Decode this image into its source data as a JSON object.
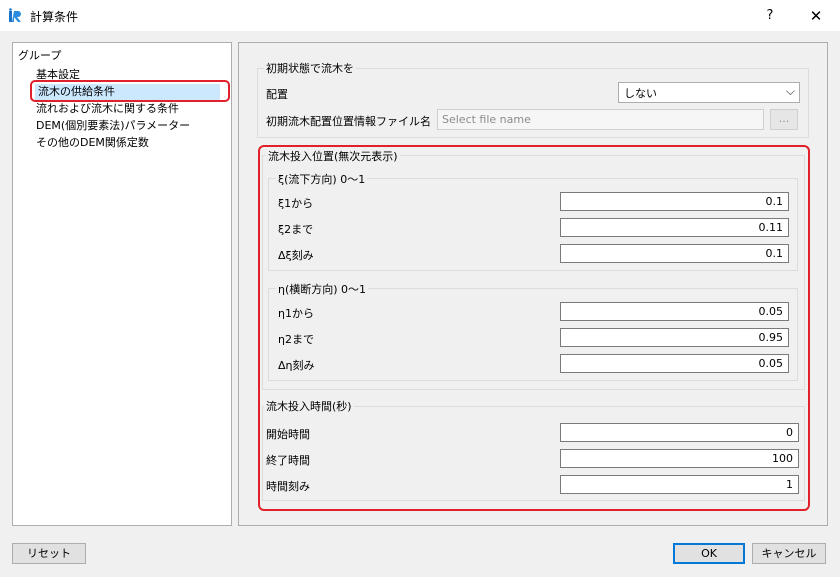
{
  "window": {
    "title": "計算条件",
    "help": "?",
    "close": "✕"
  },
  "group": {
    "title": "グループ",
    "items": [
      "基本設定",
      "流木の供給条件",
      "流れおよび流木に関する条件",
      "DEM(個別要素法)パラメーター",
      "その他のDEM関係定数"
    ]
  },
  "initial": {
    "title": "初期状態で流木を",
    "placement_label": "配置",
    "placement_value": "しない",
    "file_label": "初期流木配置位置情報ファイル名",
    "file_placeholder": "Select file name",
    "browse": "..."
  },
  "position": {
    "title": "流木投入位置(無次元表示)",
    "xi": {
      "title": "ξ(流下方向) 0〜1",
      "from_label": "ξ1から",
      "from_value": "0.1",
      "to_label": "ξ2まで",
      "to_value": "0.11",
      "step_label": "Δξ刻み",
      "step_value": "0.1"
    },
    "eta": {
      "title": "η(横断方向) 0〜1",
      "from_label": "η1から",
      "from_value": "0.05",
      "to_label": "η2まで",
      "to_value": "0.95",
      "step_label": "Δη刻み",
      "step_value": "0.05"
    }
  },
  "time": {
    "title": "流木投入時間(秒)",
    "start_label": "開始時間",
    "start_value": "0",
    "end_label": "終了時間",
    "end_value": "100",
    "step_label": "時間刻み",
    "step_value": "1"
  },
  "buttons": {
    "reset": "リセット",
    "ok": "OK",
    "cancel": "キャンセル"
  },
  "colors": {
    "highlight": "#e0202a",
    "selection": "#cce8ff",
    "focus": "#0078d7"
  }
}
